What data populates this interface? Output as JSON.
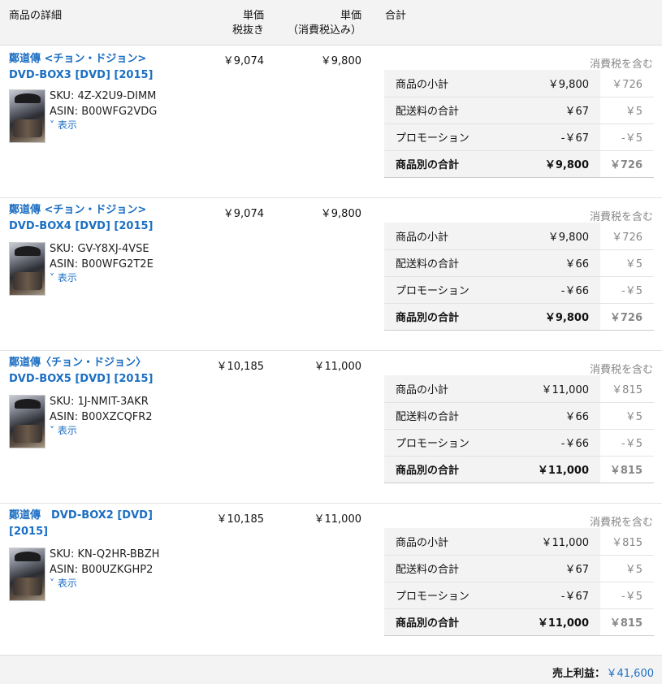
{
  "header": {
    "details": "商品の詳細",
    "price_ex_line1": "単価",
    "price_ex_line2": "税抜き",
    "price_in_line1": "単価",
    "price_in_line2": "（消費税込み）",
    "total": "合計"
  },
  "orders": [
    {
      "title": "鄭道傳 <チョン・ドジョン> DVD-BOX3 [DVD] [2015]",
      "price_ex": "￥9,074",
      "price_in": "￥9,800",
      "sku": "SKU: 4Z-X2U9-DIMM",
      "asin": "ASIN: B00WFG2VDG",
      "show": "˅ 表示",
      "tax_note": "消費税を含む",
      "rows": [
        {
          "label": "商品の小計",
          "amount": "￥9,800",
          "tax": "￥726"
        },
        {
          "label": "配送料の合計",
          "amount": "￥67",
          "tax": "￥5"
        },
        {
          "label": "プロモーション",
          "amount": "-￥67",
          "tax": "-￥5"
        },
        {
          "label": "商品別の合計",
          "amount": "￥9,800",
          "tax": "￥726"
        }
      ]
    },
    {
      "title": "鄭道傳 <チョン・ドジョン> DVD-BOX4 [DVD] [2015]",
      "price_ex": "￥9,074",
      "price_in": "￥9,800",
      "sku": "SKU: GV-Y8XJ-4VSE",
      "asin": "ASIN: B00WFG2T2E",
      "show": "˅ 表示",
      "tax_note": "消費税を含む",
      "rows": [
        {
          "label": "商品の小計",
          "amount": "￥9,800",
          "tax": "￥726"
        },
        {
          "label": "配送料の合計",
          "amount": "￥66",
          "tax": "￥5"
        },
        {
          "label": "プロモーション",
          "amount": "-￥66",
          "tax": "-￥5"
        },
        {
          "label": "商品別の合計",
          "amount": "￥9,800",
          "tax": "￥726"
        }
      ]
    },
    {
      "title": "鄭道傳〈チョン・ドジョン〉 DVD-BOX5 [DVD] [2015]",
      "price_ex": "￥10,185",
      "price_in": "￥11,000",
      "sku": "SKU: 1J-NMIT-3AKR",
      "asin": "ASIN: B00XZCQFR2",
      "show": "˅ 表示",
      "tax_note": "消費税を含む",
      "rows": [
        {
          "label": "商品の小計",
          "amount": "￥11,000",
          "tax": "￥815"
        },
        {
          "label": "配送料の合計",
          "amount": "￥66",
          "tax": "￥5"
        },
        {
          "label": "プロモーション",
          "amount": "-￥66",
          "tax": "-￥5"
        },
        {
          "label": "商品別の合計",
          "amount": "￥11,000",
          "tax": "￥815"
        }
      ]
    },
    {
      "title": "鄭道傳　DVD-BOX2 [DVD] [2015]",
      "price_ex": "￥10,185",
      "price_in": "￥11,000",
      "sku": "SKU: KN-Q2HR-BBZH",
      "asin": "ASIN: B00UZKGHP2",
      "show": "˅ 表示",
      "tax_note": "消費税を含む",
      "rows": [
        {
          "label": "商品の小計",
          "amount": "￥11,000",
          "tax": "￥815"
        },
        {
          "label": "配送料の合計",
          "amount": "￥67",
          "tax": "￥5"
        },
        {
          "label": "プロモーション",
          "amount": "-￥67",
          "tax": "-￥5"
        },
        {
          "label": "商品別の合計",
          "amount": "￥11,000",
          "tax": "￥815"
        }
      ]
    }
  ],
  "footer": {
    "label": "売上利益：",
    "value": "￥41,600"
  },
  "colors": {
    "link": "#1b6ec2",
    "header_bg": "#f3f3f3",
    "muted": "#888888"
  }
}
